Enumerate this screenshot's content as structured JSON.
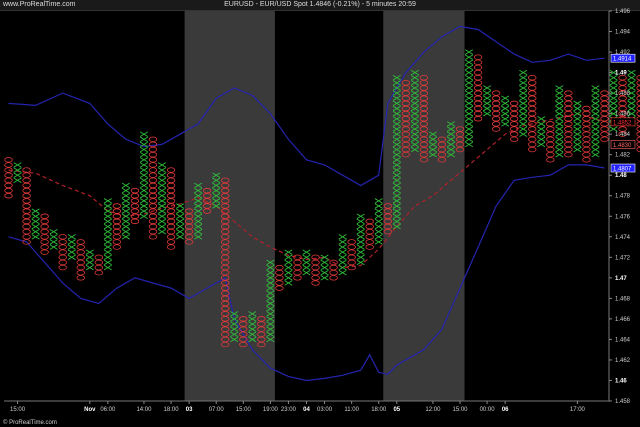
{
  "header": {
    "site": "www.ProRealTime.com",
    "title": "EURUSD - EUR/USD Spot   1.4846 (-0.21%) - 5 minutes  20:59"
  },
  "footer": {
    "credit": "© ProRealTime.com"
  },
  "price_tags": [
    {
      "label": "1.4914",
      "value": 1.4914,
      "color": "#2222ff",
      "text_color": "#ffffff"
    },
    {
      "label": "1.4852",
      "value": 1.4852,
      "color": "#000000",
      "text_color": "#ff3333"
    },
    {
      "label": "1.4830",
      "value": 1.483,
      "color": "#000000",
      "text_color": "#ff6666"
    },
    {
      "label": "1.4807",
      "value": 1.4807,
      "color": "#2222ff",
      "text_color": "#ffffff"
    }
  ],
  "colors": {
    "x": "#2fbf3a",
    "o": "#e23a3a",
    "band": "#2424b0",
    "mid": "#b0202a",
    "shade": "#3a3a3a"
  },
  "chart_data": {
    "type": "point-and-figure",
    "symbol": "EURUSD",
    "ylim": [
      1.458,
      1.496
    ],
    "box_size": 0.0005,
    "y_ticks": [
      "1.458",
      "1.46",
      "1.462",
      "1.464",
      "1.466",
      "1.468",
      "1.47",
      "1.472",
      "1.474",
      "1.476",
      "1.478",
      "1.48",
      "1.482",
      "1.484",
      "1.486",
      "1.488",
      "1.49",
      "1.492",
      "1.494",
      "1.496"
    ],
    "x_ticks": [
      {
        "label": "15:00",
        "col": 1,
        "bold": false
      },
      {
        "label": "Nov",
        "col": 9,
        "bold": true
      },
      {
        "label": "06:00",
        "col": 11,
        "bold": false
      },
      {
        "label": "14:00",
        "col": 15,
        "bold": false
      },
      {
        "label": "18:00",
        "col": 18,
        "bold": false
      },
      {
        "label": "03",
        "col": 20,
        "bold": true
      },
      {
        "label": "07:00",
        "col": 23,
        "bold": false
      },
      {
        "label": "15:00",
        "col": 26,
        "bold": false
      },
      {
        "label": "19:00",
        "col": 29,
        "bold": false
      },
      {
        "label": "23:00",
        "col": 31,
        "bold": false
      },
      {
        "label": "04",
        "col": 33,
        "bold": true
      },
      {
        "label": "03:00",
        "col": 35,
        "bold": false
      },
      {
        "label": "11:00",
        "col": 38,
        "bold": false
      },
      {
        "label": "18:00",
        "col": 41,
        "bold": false
      },
      {
        "label": "05",
        "col": 43,
        "bold": true
      },
      {
        "label": "12:00",
        "col": 47,
        "bold": false
      },
      {
        "label": "15:00",
        "col": 50,
        "bold": false
      },
      {
        "label": "00:00",
        "col": 53,
        "bold": false
      },
      {
        "label": "06",
        "col": 55,
        "bold": true
      },
      {
        "label": "17:00",
        "col": 63,
        "bold": false
      }
    ],
    "shaded_columns": [
      [
        20,
        30
      ],
      [
        42,
        51
      ]
    ],
    "columns": [
      {
        "t": "o",
        "hi": 1.4815,
        "lo": 1.478
      },
      {
        "t": "x",
        "hi": 1.481,
        "lo": 1.4795
      },
      {
        "t": "o",
        "hi": 1.4805,
        "lo": 1.4735
      },
      {
        "t": "x",
        "hi": 1.4765,
        "lo": 1.474
      },
      {
        "t": "o",
        "hi": 1.476,
        "lo": 1.4725
      },
      {
        "t": "x",
        "hi": 1.4745,
        "lo": 1.473
      },
      {
        "t": "o",
        "hi": 1.474,
        "lo": 1.471
      },
      {
        "t": "x",
        "hi": 1.474,
        "lo": 1.472
      },
      {
        "t": "o",
        "hi": 1.4735,
        "lo": 1.47
      },
      {
        "t": "x",
        "hi": 1.4725,
        "lo": 1.471
      },
      {
        "t": "o",
        "hi": 1.472,
        "lo": 1.4705
      },
      {
        "t": "x",
        "hi": 1.4775,
        "lo": 1.471
      },
      {
        "t": "o",
        "hi": 1.477,
        "lo": 1.473
      },
      {
        "t": "x",
        "hi": 1.479,
        "lo": 1.474
      },
      {
        "t": "o",
        "hi": 1.4785,
        "lo": 1.4755
      },
      {
        "t": "x",
        "hi": 1.484,
        "lo": 1.476
      },
      {
        "t": "o",
        "hi": 1.4835,
        "lo": 1.474
      },
      {
        "t": "x",
        "hi": 1.481,
        "lo": 1.4745
      },
      {
        "t": "o",
        "hi": 1.4805,
        "lo": 1.473
      },
      {
        "t": "x",
        "hi": 1.477,
        "lo": 1.474
      },
      {
        "t": "o",
        "hi": 1.4765,
        "lo": 1.4735
      },
      {
        "t": "x",
        "hi": 1.479,
        "lo": 1.474
      },
      {
        "t": "o",
        "hi": 1.4785,
        "lo": 1.4765
      },
      {
        "t": "x",
        "hi": 1.48,
        "lo": 1.477
      },
      {
        "t": "o",
        "hi": 1.4795,
        "lo": 1.4635
      },
      {
        "t": "x",
        "hi": 1.4665,
        "lo": 1.464
      },
      {
        "t": "o",
        "hi": 1.466,
        "lo": 1.4635
      },
      {
        "t": "x",
        "hi": 1.4665,
        "lo": 1.464
      },
      {
        "t": "o",
        "hi": 1.466,
        "lo": 1.4635
      },
      {
        "t": "x",
        "hi": 1.4715,
        "lo": 1.464
      },
      {
        "t": "o",
        "hi": 1.471,
        "lo": 1.469
      },
      {
        "t": "x",
        "hi": 1.4725,
        "lo": 1.4695
      },
      {
        "t": "o",
        "hi": 1.472,
        "lo": 1.47
      },
      {
        "t": "x",
        "hi": 1.4725,
        "lo": 1.4705
      },
      {
        "t": "o",
        "hi": 1.472,
        "lo": 1.4695
      },
      {
        "t": "x",
        "hi": 1.472,
        "lo": 1.47
      },
      {
        "t": "o",
        "hi": 1.4715,
        "lo": 1.47
      },
      {
        "t": "x",
        "hi": 1.474,
        "lo": 1.4705
      },
      {
        "t": "o",
        "hi": 1.4735,
        "lo": 1.471
      },
      {
        "t": "x",
        "hi": 1.476,
        "lo": 1.4715
      },
      {
        "t": "o",
        "hi": 1.4755,
        "lo": 1.473
      },
      {
        "t": "x",
        "hi": 1.4775,
        "lo": 1.4735
      },
      {
        "t": "o",
        "hi": 1.477,
        "lo": 1.4745
      },
      {
        "t": "x",
        "hi": 1.4895,
        "lo": 1.475
      },
      {
        "t": "o",
        "hi": 1.489,
        "lo": 1.482
      },
      {
        "t": "x",
        "hi": 1.49,
        "lo": 1.4825
      },
      {
        "t": "o",
        "hi": 1.4895,
        "lo": 1.4815
      },
      {
        "t": "x",
        "hi": 1.484,
        "lo": 1.482
      },
      {
        "t": "o",
        "hi": 1.4835,
        "lo": 1.4815
      },
      {
        "t": "x",
        "hi": 1.485,
        "lo": 1.482
      },
      {
        "t": "o",
        "hi": 1.4845,
        "lo": 1.4825
      },
      {
        "t": "x",
        "hi": 1.492,
        "lo": 1.483
      },
      {
        "t": "o",
        "hi": 1.4915,
        "lo": 1.4855
      },
      {
        "t": "x",
        "hi": 1.4885,
        "lo": 1.486
      },
      {
        "t": "o",
        "hi": 1.488,
        "lo": 1.4845
      },
      {
        "t": "x",
        "hi": 1.4875,
        "lo": 1.485
      },
      {
        "t": "o",
        "hi": 1.487,
        "lo": 1.4835
      },
      {
        "t": "x",
        "hi": 1.49,
        "lo": 1.484
      },
      {
        "t": "o",
        "hi": 1.4895,
        "lo": 1.4825
      },
      {
        "t": "x",
        "hi": 1.4855,
        "lo": 1.483
      },
      {
        "t": "o",
        "hi": 1.485,
        "lo": 1.4815
      },
      {
        "t": "x",
        "hi": 1.4885,
        "lo": 1.482
      },
      {
        "t": "o",
        "hi": 1.488,
        "lo": 1.482
      },
      {
        "t": "x",
        "hi": 1.487,
        "lo": 1.4825
      },
      {
        "t": "o",
        "hi": 1.4865,
        "lo": 1.4815
      },
      {
        "t": "x",
        "hi": 1.4885,
        "lo": 1.482
      },
      {
        "t": "o",
        "hi": 1.488,
        "lo": 1.4835
      },
      {
        "t": "x",
        "hi": 1.49,
        "lo": 1.4845
      },
      {
        "t": "o",
        "hi": 1.4895,
        "lo": 1.484
      },
      {
        "t": "x",
        "hi": 1.49,
        "lo": 1.485
      },
      {
        "t": "o",
        "hi": 1.4895,
        "lo": 1.4825
      },
      {
        "t": "x",
        "hi": 1.484,
        "lo": 1.4825
      },
      {
        "t": "o",
        "hi": 1.484,
        "lo": 1.482
      }
    ],
    "upper_band": [
      [
        0,
        1.487
      ],
      [
        3,
        1.4868
      ],
      [
        6,
        1.488
      ],
      [
        9,
        1.487
      ],
      [
        11,
        1.485
      ],
      [
        13,
        1.4835
      ],
      [
        15,
        1.4828
      ],
      [
        17,
        1.483
      ],
      [
        19,
        1.484
      ],
      [
        21,
        1.485
      ],
      [
        23,
        1.4875
      ],
      [
        25,
        1.4885
      ],
      [
        27,
        1.4878
      ],
      [
        29,
        1.486
      ],
      [
        31,
        1.4835
      ],
      [
        33,
        1.4815
      ],
      [
        35,
        1.481
      ],
      [
        37,
        1.48
      ],
      [
        39,
        1.479
      ],
      [
        41,
        1.48
      ],
      [
        42,
        1.487
      ],
      [
        44,
        1.49
      ],
      [
        46,
        1.492
      ],
      [
        48,
        1.4935
      ],
      [
        50,
        1.4945
      ],
      [
        52,
        1.4942
      ],
      [
        54,
        1.493
      ],
      [
        56,
        1.4918
      ],
      [
        58,
        1.491
      ],
      [
        60,
        1.4912
      ],
      [
        62,
        1.4918
      ],
      [
        64,
        1.4912
      ],
      [
        66,
        1.4914
      ]
    ],
    "lower_band": [
      [
        0,
        1.474
      ],
      [
        2,
        1.4735
      ],
      [
        4,
        1.4715
      ],
      [
        6,
        1.4695
      ],
      [
        8,
        1.468
      ],
      [
        10,
        1.4675
      ],
      [
        12,
        1.469
      ],
      [
        14,
        1.47
      ],
      [
        16,
        1.4695
      ],
      [
        18,
        1.469
      ],
      [
        20,
        1.468
      ],
      [
        22,
        1.469
      ],
      [
        24,
        1.47
      ],
      [
        25,
        1.466
      ],
      [
        27,
        1.463
      ],
      [
        29,
        1.4612
      ],
      [
        31,
        1.4604
      ],
      [
        33,
        1.46
      ],
      [
        35,
        1.4602
      ],
      [
        37,
        1.4605
      ],
      [
        39,
        1.461
      ],
      [
        40,
        1.4625
      ],
      [
        41,
        1.4608
      ],
      [
        42,
        1.4606
      ],
      [
        43,
        1.4615
      ],
      [
        44,
        1.462
      ],
      [
        46,
        1.463
      ],
      [
        48,
        1.465
      ],
      [
        50,
        1.469
      ],
      [
        52,
        1.473
      ],
      [
        54,
        1.477
      ],
      [
        56,
        1.4795
      ],
      [
        58,
        1.4798
      ],
      [
        60,
        1.48
      ],
      [
        62,
        1.481
      ],
      [
        64,
        1.481
      ],
      [
        66,
        1.4807
      ]
    ],
    "mid_band": [
      [
        0,
        1.4805
      ],
      [
        3,
        1.4802
      ],
      [
        6,
        1.479
      ],
      [
        9,
        1.478
      ],
      [
        11,
        1.4765
      ],
      [
        13,
        1.476
      ],
      [
        15,
        1.4762
      ],
      [
        17,
        1.4768
      ],
      [
        19,
        1.4772
      ],
      [
        21,
        1.4778
      ],
      [
        23,
        1.477
      ],
      [
        25,
        1.4755
      ],
      [
        27,
        1.474
      ],
      [
        29,
        1.473
      ],
      [
        31,
        1.4722
      ],
      [
        33,
        1.4718
      ],
      [
        35,
        1.472
      ],
      [
        37,
        1.471
      ],
      [
        39,
        1.4712
      ],
      [
        41,
        1.4728
      ],
      [
        43,
        1.475
      ],
      [
        45,
        1.477
      ],
      [
        47,
        1.478
      ],
      [
        49,
        1.4795
      ],
      [
        51,
        1.481
      ],
      [
        53,
        1.4825
      ],
      [
        55,
        1.484
      ],
      [
        57,
        1.4848
      ],
      [
        59,
        1.4852
      ],
      [
        61,
        1.4856
      ],
      [
        63,
        1.486
      ],
      [
        66,
        1.4852
      ]
    ]
  }
}
